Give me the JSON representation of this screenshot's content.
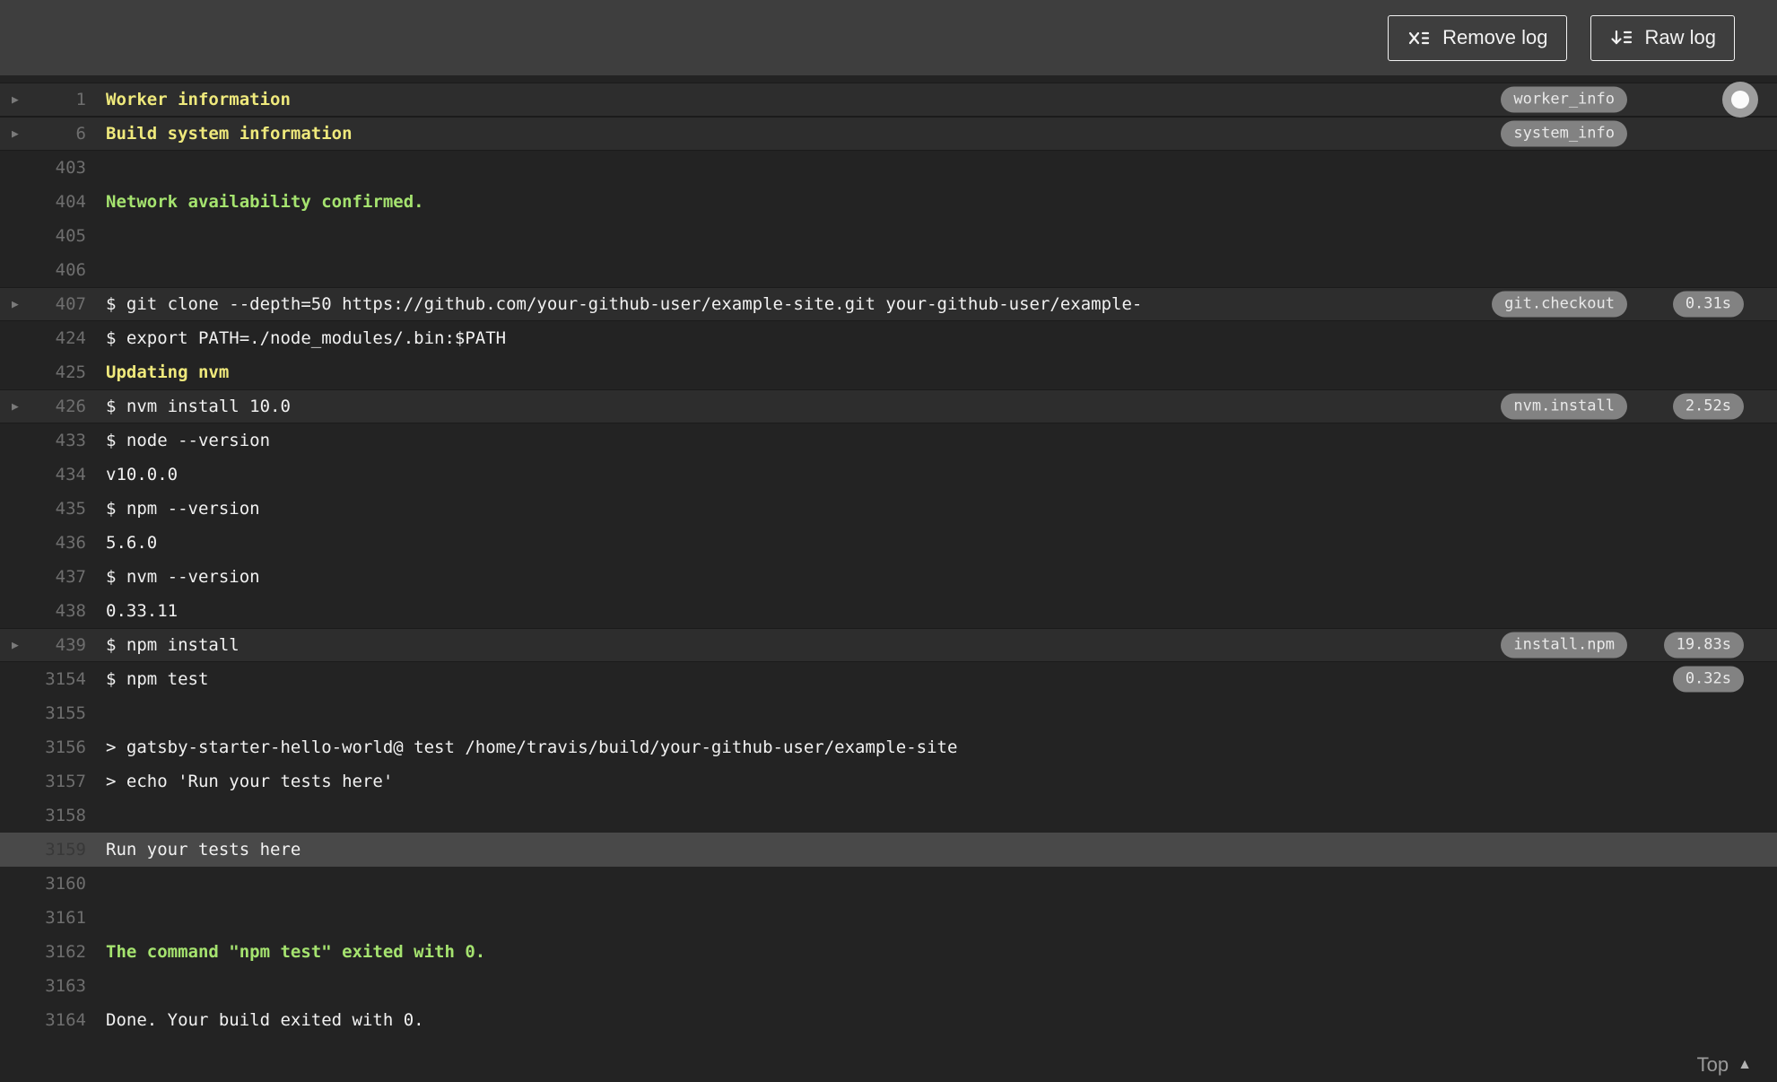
{
  "header": {
    "remove_log_label": "Remove log",
    "raw_log_label": "Raw log"
  },
  "footer": {
    "top_label": "Top"
  },
  "icons": {
    "fold_arrow": "▶",
    "top_arrow": "▲"
  },
  "colors": {
    "yellow": "#efe97c",
    "green": "#a5e36f",
    "white": "#f1f1f1",
    "badge_bg": "#828282",
    "badge_text": "#e9e9e9",
    "topbar_bg": "#3e3e3e",
    "log_bg": "#232323",
    "fold_row_bg": "#2d2d2d",
    "highlight_row_bg": "#494949"
  },
  "log": {
    "rows": [
      {
        "line": "1",
        "text": "Worker information",
        "color": "yellow",
        "bold": true,
        "fold": true,
        "badge": "worker_info",
        "duration": null,
        "highlight": false,
        "indicator": true
      },
      {
        "line": "6",
        "text": "Build system information",
        "color": "yellow",
        "bold": true,
        "fold": true,
        "badge": "system_info",
        "duration": null,
        "highlight": false,
        "indicator": false
      },
      {
        "line": "403",
        "text": "",
        "color": null,
        "bold": false,
        "fold": false,
        "badge": null,
        "duration": null,
        "highlight": false,
        "indicator": false
      },
      {
        "line": "404",
        "text": "Network availability confirmed.",
        "color": "green",
        "bold": true,
        "fold": false,
        "badge": null,
        "duration": null,
        "highlight": false,
        "indicator": false
      },
      {
        "line": "405",
        "text": "",
        "color": null,
        "bold": false,
        "fold": false,
        "badge": null,
        "duration": null,
        "highlight": false,
        "indicator": false
      },
      {
        "line": "406",
        "text": "",
        "color": null,
        "bold": false,
        "fold": false,
        "badge": null,
        "duration": null,
        "highlight": false,
        "indicator": false
      },
      {
        "line": "407",
        "text": "$ git clone --depth=50 https://github.com/your-github-user/example-site.git your-github-user/example-",
        "color": null,
        "bold": false,
        "fold": true,
        "badge": "git.checkout",
        "duration": "0.31s",
        "highlight": false,
        "indicator": false
      },
      {
        "line": "424",
        "text": "$ export PATH=./node_modules/.bin:$PATH",
        "color": null,
        "bold": false,
        "fold": false,
        "badge": null,
        "duration": null,
        "highlight": false,
        "indicator": false
      },
      {
        "line": "425",
        "text": "Updating nvm",
        "color": "yellow",
        "bold": true,
        "fold": false,
        "badge": null,
        "duration": null,
        "highlight": false,
        "indicator": false
      },
      {
        "line": "426",
        "text": "$ nvm install 10.0",
        "color": null,
        "bold": false,
        "fold": true,
        "badge": "nvm.install",
        "duration": "2.52s",
        "highlight": false,
        "indicator": false
      },
      {
        "line": "433",
        "text": "$ node --version",
        "color": null,
        "bold": false,
        "fold": false,
        "badge": null,
        "duration": null,
        "highlight": false,
        "indicator": false
      },
      {
        "line": "434",
        "text": "v10.0.0",
        "color": null,
        "bold": false,
        "fold": false,
        "badge": null,
        "duration": null,
        "highlight": false,
        "indicator": false
      },
      {
        "line": "435",
        "text": "$ npm --version",
        "color": null,
        "bold": false,
        "fold": false,
        "badge": null,
        "duration": null,
        "highlight": false,
        "indicator": false
      },
      {
        "line": "436",
        "text": "5.6.0",
        "color": null,
        "bold": false,
        "fold": false,
        "badge": null,
        "duration": null,
        "highlight": false,
        "indicator": false
      },
      {
        "line": "437",
        "text": "$ nvm --version",
        "color": null,
        "bold": false,
        "fold": false,
        "badge": null,
        "duration": null,
        "highlight": false,
        "indicator": false
      },
      {
        "line": "438",
        "text": "0.33.11",
        "color": null,
        "bold": false,
        "fold": false,
        "badge": null,
        "duration": null,
        "highlight": false,
        "indicator": false
      },
      {
        "line": "439",
        "text": "$ npm install",
        "color": null,
        "bold": false,
        "fold": true,
        "badge": "install.npm",
        "duration": "19.83s",
        "highlight": false,
        "indicator": false
      },
      {
        "line": "3154",
        "text": "$ npm test",
        "color": null,
        "bold": false,
        "fold": false,
        "badge": null,
        "duration": "0.32s",
        "highlight": false,
        "indicator": false
      },
      {
        "line": "3155",
        "text": "",
        "color": null,
        "bold": false,
        "fold": false,
        "badge": null,
        "duration": null,
        "highlight": false,
        "indicator": false
      },
      {
        "line": "3156",
        "text": "> gatsby-starter-hello-world@ test /home/travis/build/your-github-user/example-site",
        "color": null,
        "bold": false,
        "fold": false,
        "badge": null,
        "duration": null,
        "highlight": false,
        "indicator": false
      },
      {
        "line": "3157",
        "text": "> echo 'Run your tests here'",
        "color": null,
        "bold": false,
        "fold": false,
        "badge": null,
        "duration": null,
        "highlight": false,
        "indicator": false
      },
      {
        "line": "3158",
        "text": "",
        "color": null,
        "bold": false,
        "fold": false,
        "badge": null,
        "duration": null,
        "highlight": false,
        "indicator": false
      },
      {
        "line": "3159",
        "text": "Run your tests here",
        "color": null,
        "bold": false,
        "fold": false,
        "badge": null,
        "duration": null,
        "highlight": true,
        "indicator": false
      },
      {
        "line": "3160",
        "text": "",
        "color": null,
        "bold": false,
        "fold": false,
        "badge": null,
        "duration": null,
        "highlight": false,
        "indicator": false
      },
      {
        "line": "3161",
        "text": "",
        "color": null,
        "bold": false,
        "fold": false,
        "badge": null,
        "duration": null,
        "highlight": false,
        "indicator": false
      },
      {
        "line": "3162",
        "text": "The command \"npm test\" exited with 0.",
        "color": "green",
        "bold": true,
        "fold": false,
        "badge": null,
        "duration": null,
        "highlight": false,
        "indicator": false
      },
      {
        "line": "3163",
        "text": "",
        "color": null,
        "bold": false,
        "fold": false,
        "badge": null,
        "duration": null,
        "highlight": false,
        "indicator": false
      },
      {
        "line": "3164",
        "text": "Done. Your build exited with 0.",
        "color": null,
        "bold": false,
        "fold": false,
        "badge": null,
        "duration": null,
        "highlight": false,
        "indicator": false
      }
    ]
  }
}
